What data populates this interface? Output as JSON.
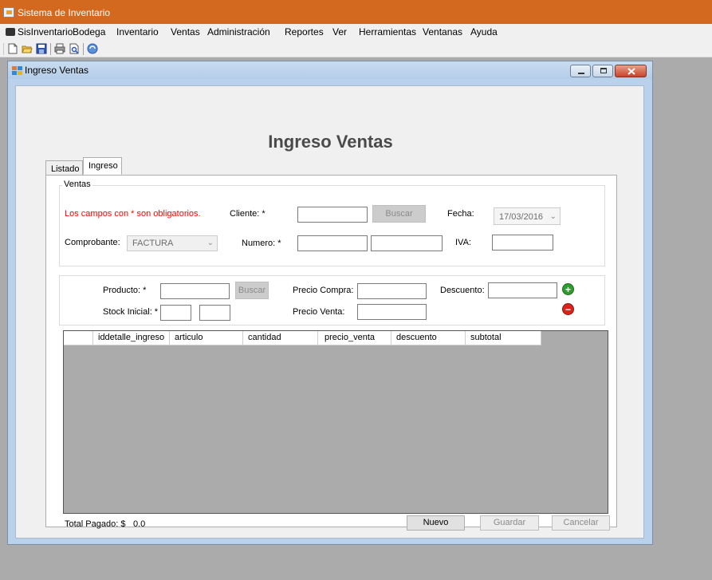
{
  "app": {
    "title": "Sistema de Inventario"
  },
  "menu": {
    "items": [
      "SisInventario",
      "Bodega",
      "Inventario",
      "Ventas",
      "Administración",
      "Reportes",
      "Ver",
      "Herramientas",
      "Ventanas",
      "Ayuda"
    ]
  },
  "toolbar": {
    "icons": [
      "new-icon",
      "open-icon",
      "save-icon",
      "print-icon",
      "print-preview-icon",
      "help-icon"
    ]
  },
  "window": {
    "title": "Ingreso Ventas",
    "page_title": "Ingreso Ventas"
  },
  "tabs": [
    {
      "label": "Listado",
      "active": false
    },
    {
      "label": "Ingreso",
      "active": true
    }
  ],
  "ventas": {
    "legend": "Ventas",
    "required_note": "Los campos con * son obligatorios.",
    "cliente_label": "Cliente: *",
    "cliente_value": "",
    "buscar_label": "Buscar",
    "fecha_label": "Fecha:",
    "fecha_value": "17/03/2016",
    "comprobante_label": "Comprobante:",
    "comprobante_value": "FACTURA",
    "numero_label": "Numero: *",
    "iva_label": "IVA:"
  },
  "producto": {
    "producto_label": "Producto: *",
    "buscar_label": "Buscar",
    "precio_compra_label": "Precio Compra:",
    "descuento_label": "Descuento:",
    "stock_label": "Stock Inicial: *",
    "precio_venta_label": "Precio Venta:"
  },
  "grid": {
    "columns": [
      "",
      "iddetalle_ingreso",
      "articulo",
      "cantidad",
      "precio_venta",
      "descuento",
      "subtotal"
    ]
  },
  "footer": {
    "total_label": "Total Pagado: $",
    "total_value": "0.0",
    "nuevo_label": "Nuevo",
    "guardar_label": "Guardar",
    "cancelar_label": "Cancelar"
  },
  "colors": {
    "title_bar": "#d2691e",
    "required_text": "#ff0000",
    "add_icon": "#2e9d2e",
    "remove_icon": "#d9241b"
  }
}
